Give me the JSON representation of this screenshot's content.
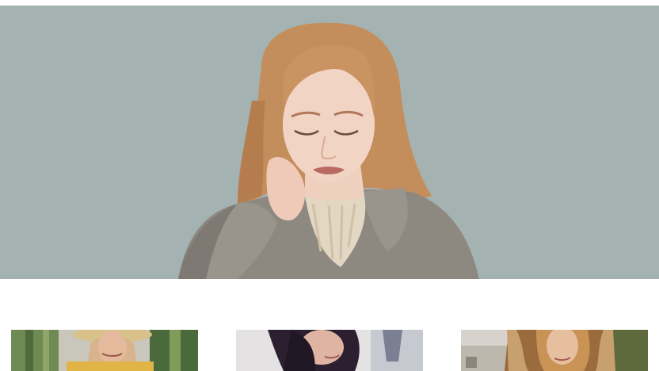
{
  "hero": {
    "image": "portrait-red-hair-grey-coat",
    "background_color": "#a4b2b1"
  },
  "gallery": {
    "thumbnails": [
      {
        "image": "woman-straw-hat-yellow-top-cactus"
      },
      {
        "image": "woman-dark-hair-profile"
      },
      {
        "image": "woman-fur-hood"
      }
    ]
  }
}
